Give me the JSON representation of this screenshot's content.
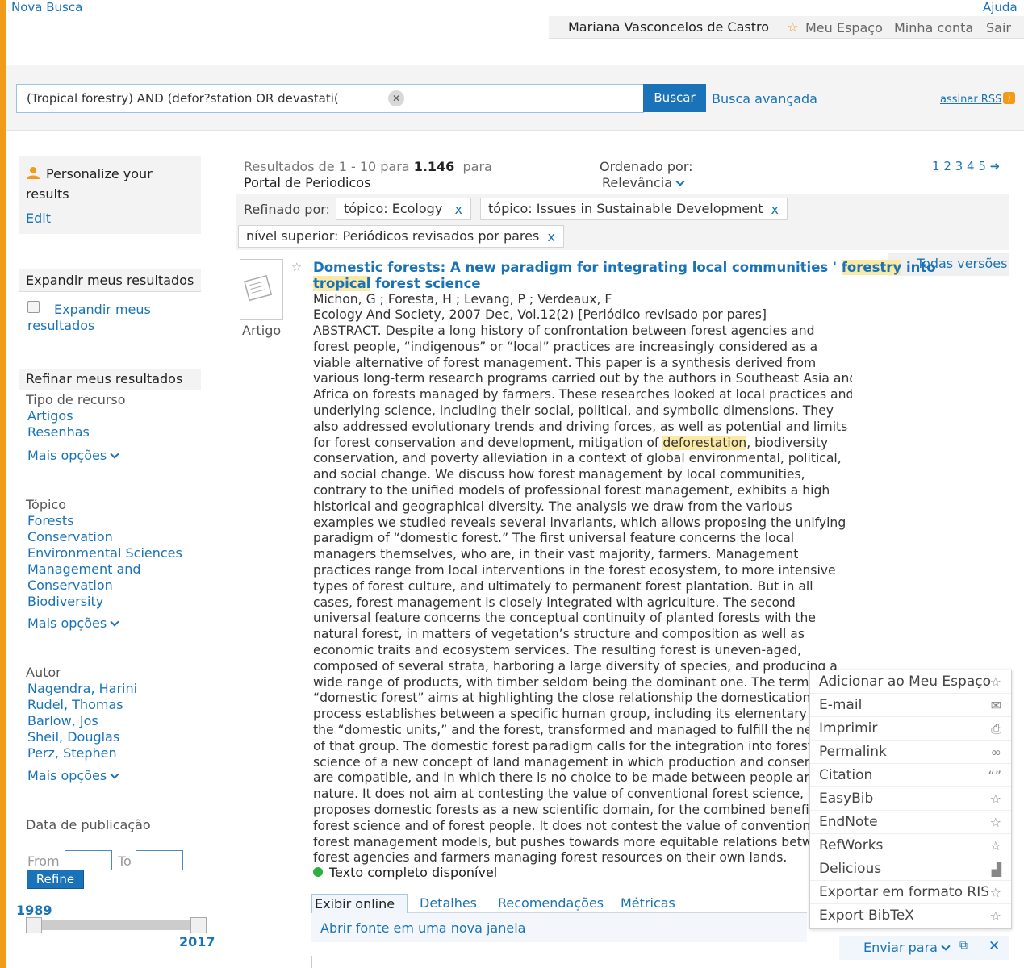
{
  "colors": {
    "accent": "#1a73b8",
    "orange": "#f29b1b",
    "highlight": "#fbe9a6",
    "available": "#2eae3c"
  },
  "header": {
    "new_search": "Nova Busca",
    "help": "Ajuda",
    "user_name": "Mariana Vasconcelos de Castro",
    "my_space": "Meu Espaço",
    "my_account": "Minha conta",
    "logout": "Sair"
  },
  "search": {
    "query": "(Tropical forestry) AND  (defor?station OR devastati(",
    "button": "Buscar",
    "advanced": "Busca avançada",
    "rss": "assinar RSS"
  },
  "sidebar": {
    "personalize": {
      "title_line1": "Personalize your",
      "title_line2": "results",
      "edit": "Edit"
    },
    "expand": {
      "title": "Expandir meus resultados",
      "checkbox_line1": "Expandir meus",
      "checkbox_line2": "resultados"
    },
    "refine_title": "Refinar meus resultados",
    "resource_type": {
      "label": "Tipo de recurso",
      "items": [
        "Artigos",
        "Resenhas"
      ],
      "more": "Mais opções"
    },
    "topic": {
      "label": "Tópico",
      "items": [
        "Forests",
        "Conservation",
        "Environmental Sciences",
        "Management and",
        "Conservation",
        "Biodiversity"
      ],
      "more": "Mais opções"
    },
    "author": {
      "label": "Autor",
      "items": [
        "Nagendra, Harini",
        "Rudel, Thomas",
        "Barlow, Jos",
        "Sheil, Douglas",
        "Perz, Stephen"
      ],
      "more": "Mais opções"
    },
    "pub_date": {
      "label": "Data de publicação",
      "from": "From",
      "to": "To",
      "refine": "Refine",
      "min_year": "1989",
      "max_year": "2017"
    }
  },
  "results": {
    "summary_prefix": "Resultados de 1 - 10 para",
    "count": "1.146",
    "summary_suffix": "para",
    "scope": "Portal de Periodicos",
    "sort_label": "Ordenado por:",
    "sort_value": "Relevância",
    "pages": [
      "1",
      "2",
      "3",
      "4",
      "5"
    ],
    "refined_label": "Refinado por:",
    "chips": [
      "tópico: Ecology",
      "tópico: Issues in Sustainable Development",
      "nível superior: Periódicos revisados por pares"
    ],
    "chip_remove": "x"
  },
  "record": {
    "type": "Artigo",
    "all_versions": "Todas versões",
    "title_line1_a": "Domestic forests: A new paradigm for integrating local communities ' ",
    "title_line1_hl": "forestry",
    "title_line1_b": " into",
    "title_line2_hl": "tropical",
    "title_line2_b": " forest science",
    "authors": "Michon, G ; Foresta, H ; Levang, P ; Verdeaux, F",
    "source": "Ecology And Society, 2007 Dec, Vol.12(2) [Periódico revisado por pares]",
    "abstract_pre": "ABSTRACT. Despite a long history of confrontation between forest agencies and\nforest people, “indigenous” or “local” practices are increasingly considered as a\nviable alternative of forest management. This paper is a synthesis derived from\nvarious long-term research programs carried out by the authors in Southeast Asia and\nAfrica on forests managed by farmers. These researches looked at local practices and\nunderlying science, including their social, political, and symbolic dimensions. They\nalso addressed evolutionary trends and driving forces, as well as potential and limits\nfor forest conservation and development, mitigation of ",
    "abstract_hl": "deforestation",
    "abstract_post": ", biodiversity\nconservation, and poverty alleviation in a context of global environmental, political,\nand social change. We discuss how forest management by local communities,\ncontrary to the unified models of professional forest management, exhibits a high\nhistorical and geographical diversity. The analysis we draw from the various\nexamples we studied reveals several invariants, which allows proposing the unifying\nparadigm of “domestic forest.” The first universal feature concerns the local\nmanagers themselves, who are, in their vast majority, farmers. Management\npractices range from local interventions in the forest ecosystem, to more intensive\ntypes of forest culture, and ultimately to permanent forest plantation. But in all\ncases, forest management is closely integrated with agriculture. The second\nuniversal feature concerns the conceptual continuity of planted forests with the\nnatural forest, in matters of vegetation’s structure and composition as well as\neconomic traits and ecosystem services. The resulting forest is uneven-aged,\ncomposed of several strata, harboring a large diversity of species, and producing a\nwide range of products, with timber seldom being the dominant one. The term\n“domestic forest” aims at highlighting the close relationship the domestication\nprocess establishes between a specific human group, including its elementary u\nthe “domestic units,” and the forest, transformed and managed to fulfill the ne\nof that group. The domestic forest paradigm calls for the integration into forest\nscience of a new concept of land management in which production and conserv\nare compatible, and in which there is no choice to be made between people an\nnature. It does not aim at contesting the value of conventional forest science,\nproposes domestic forests as a new scientific domain, for the combined benefit\nforest science and of forest people. It does not contest the value of convention\nforest management models, but pushes towards more equitable relations betw\nforest agencies and farmers managing forest resources on their own lands.",
    "fulltext": "Texto completo disponível",
    "tabs": [
      "Exibir online",
      "Detalhes",
      "Recomendações",
      "Métricas"
    ],
    "open_source": "Abrir fonte em uma nova janela",
    "send_to": "Enviar para"
  },
  "send_menu": [
    {
      "label": "Adicionar ao Meu Espaço",
      "icon": "star-icon"
    },
    {
      "label": "E-mail",
      "icon": "envelope-icon"
    },
    {
      "label": "Imprimir",
      "icon": "printer-icon"
    },
    {
      "label": "Permalink",
      "icon": "link-icon"
    },
    {
      "label": "Citation",
      "icon": "quote-icon"
    },
    {
      "label": "EasyBib",
      "icon": "star-icon"
    },
    {
      "label": "EndNote",
      "icon": "star-icon"
    },
    {
      "label": "RefWorks",
      "icon": "star-icon"
    },
    {
      "label": "Delicious",
      "icon": "delicious-icon"
    },
    {
      "label": "Exportar em formato RIS",
      "icon": "star-icon"
    },
    {
      "label": "Export BibTeX",
      "icon": "star-icon"
    }
  ]
}
